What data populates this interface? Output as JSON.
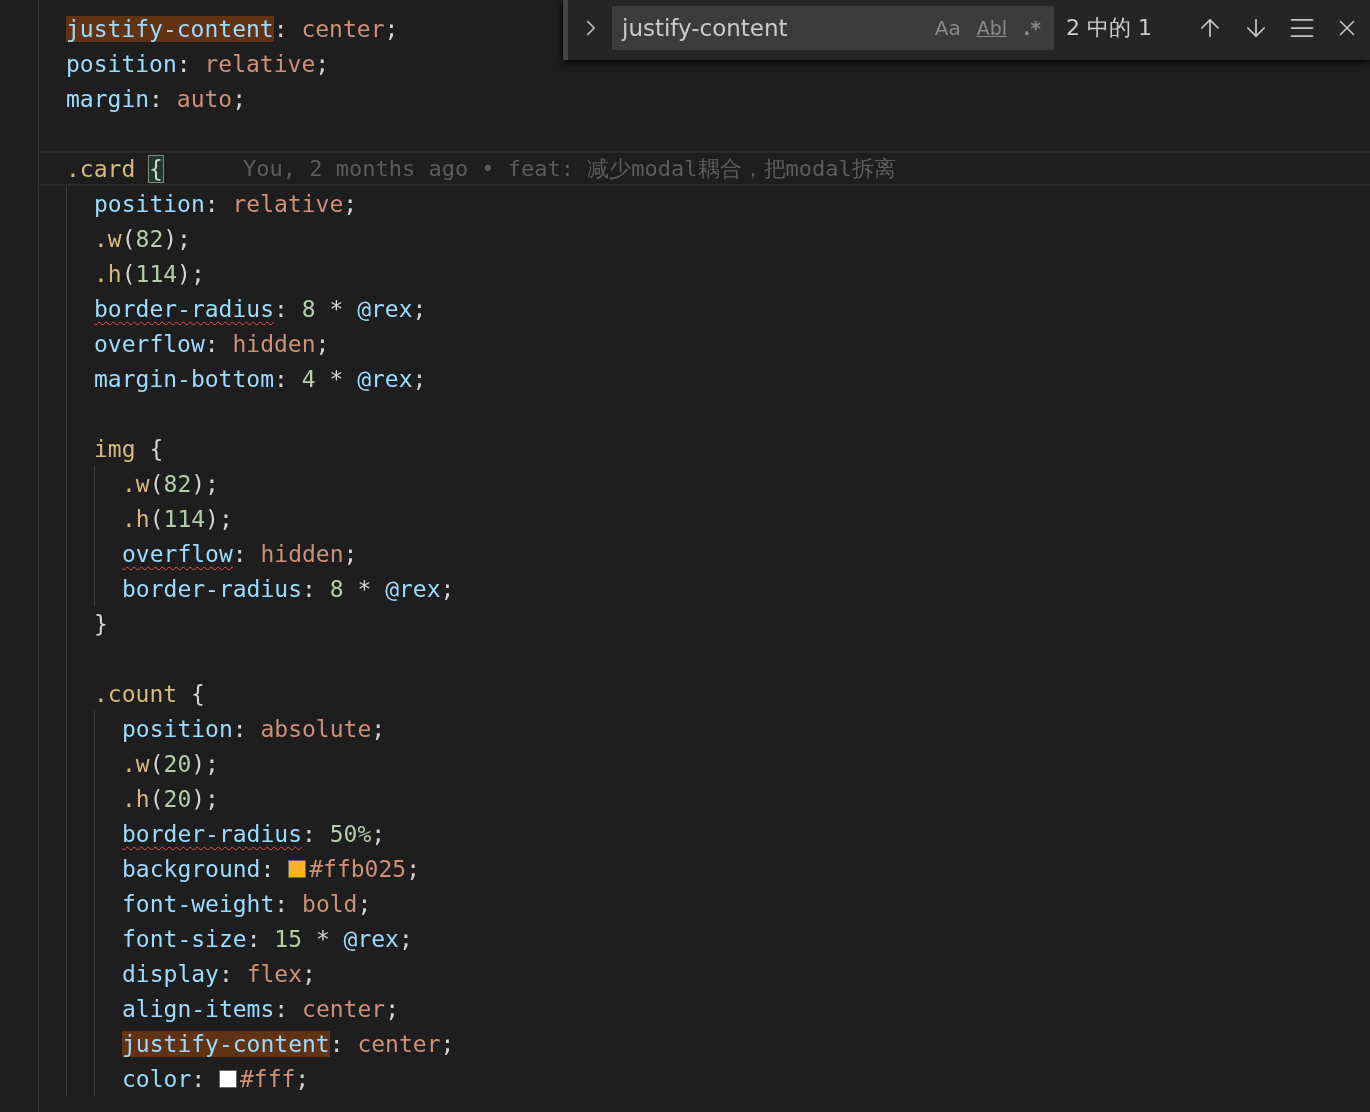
{
  "editor": {
    "lines": [
      {
        "tokens": [
          {
            "kind": "prop",
            "text": "justify-content",
            "highlighted": true
          },
          {
            "kind": "punct",
            "text": ": "
          },
          {
            "kind": "value",
            "text": "center"
          },
          {
            "kind": "punct",
            "text": ";"
          }
        ]
      },
      {
        "tokens": [
          {
            "kind": "prop",
            "text": "position"
          },
          {
            "kind": "punct",
            "text": ": "
          },
          {
            "kind": "value",
            "text": "relative"
          },
          {
            "kind": "punct",
            "text": ";"
          }
        ]
      },
      {
        "tokens": [
          {
            "kind": "prop",
            "text": "margin"
          },
          {
            "kind": "punct",
            "text": ": "
          },
          {
            "kind": "value",
            "text": "auto"
          },
          {
            "kind": "punct",
            "text": ";"
          }
        ]
      },
      {
        "kind": "blank"
      },
      {
        "current": true,
        "blame": "You, 2 months ago • feat: 减少modal耦合，把modal拆离",
        "tokens": [
          {
            "kind": "selector",
            "text": ".card "
          },
          {
            "kind": "punct",
            "text": "{",
            "bracket_match": true
          }
        ],
        "children": [
          {
            "tokens": [
              {
                "kind": "prop",
                "text": "position"
              },
              {
                "kind": "punct",
                "text": ": "
              },
              {
                "kind": "value",
                "text": "relative"
              },
              {
                "kind": "punct",
                "text": ";"
              }
            ]
          },
          {
            "tokens": [
              {
                "kind": "selector",
                "text": ".w"
              },
              {
                "kind": "punct",
                "text": "("
              },
              {
                "kind": "num",
                "text": "82"
              },
              {
                "kind": "punct",
                "text": ");"
              }
            ]
          },
          {
            "tokens": [
              {
                "kind": "selector",
                "text": ".h"
              },
              {
                "kind": "punct",
                "text": "("
              },
              {
                "kind": "num",
                "text": "114"
              },
              {
                "kind": "punct",
                "text": ");"
              }
            ]
          },
          {
            "tokens": [
              {
                "kind": "prop",
                "text": "border-radius",
                "warning": true
              },
              {
                "kind": "punct",
                "text": ": "
              },
              {
                "kind": "num",
                "text": "8"
              },
              {
                "kind": "punct",
                "text": " * "
              },
              {
                "kind": "var",
                "text": "@rex"
              },
              {
                "kind": "punct",
                "text": ";"
              }
            ]
          },
          {
            "tokens": [
              {
                "kind": "prop",
                "text": "overflow"
              },
              {
                "kind": "punct",
                "text": ": "
              },
              {
                "kind": "value",
                "text": "hidden"
              },
              {
                "kind": "punct",
                "text": ";"
              }
            ]
          },
          {
            "tokens": [
              {
                "kind": "prop",
                "text": "margin-bottom"
              },
              {
                "kind": "punct",
                "text": ": "
              },
              {
                "kind": "num",
                "text": "4"
              },
              {
                "kind": "punct",
                "text": " * "
              },
              {
                "kind": "var",
                "text": "@rex"
              },
              {
                "kind": "punct",
                "text": ";"
              }
            ]
          },
          {
            "kind": "blank"
          },
          {
            "tokens": [
              {
                "kind": "selector",
                "text": "img"
              },
              {
                "kind": "punct",
                "text": " {"
              }
            ],
            "children": [
              {
                "tokens": [
                  {
                    "kind": "selector",
                    "text": ".w"
                  },
                  {
                    "kind": "punct",
                    "text": "("
                  },
                  {
                    "kind": "num",
                    "text": "82"
                  },
                  {
                    "kind": "punct",
                    "text": ");"
                  }
                ]
              },
              {
                "tokens": [
                  {
                    "kind": "selector",
                    "text": ".h"
                  },
                  {
                    "kind": "punct",
                    "text": "("
                  },
                  {
                    "kind": "num",
                    "text": "114"
                  },
                  {
                    "kind": "punct",
                    "text": ");"
                  }
                ]
              },
              {
                "tokens": [
                  {
                    "kind": "prop",
                    "text": "overflow",
                    "warning": true
                  },
                  {
                    "kind": "punct",
                    "text": ": "
                  },
                  {
                    "kind": "value",
                    "text": "hidden"
                  },
                  {
                    "kind": "punct",
                    "text": ";"
                  }
                ]
              },
              {
                "tokens": [
                  {
                    "kind": "prop",
                    "text": "border-radius"
                  },
                  {
                    "kind": "punct",
                    "text": ": "
                  },
                  {
                    "kind": "num",
                    "text": "8"
                  },
                  {
                    "kind": "punct",
                    "text": " * "
                  },
                  {
                    "kind": "var",
                    "text": "@rex"
                  },
                  {
                    "kind": "punct",
                    "text": ";"
                  }
                ]
              }
            ]
          },
          {
            "tokens": [
              {
                "kind": "punct",
                "text": "}"
              }
            ]
          },
          {
            "kind": "blank"
          },
          {
            "tokens": [
              {
                "kind": "selector",
                "text": ".count"
              },
              {
                "kind": "punct",
                "text": " {"
              }
            ],
            "children": [
              {
                "tokens": [
                  {
                    "kind": "prop",
                    "text": "position"
                  },
                  {
                    "kind": "punct",
                    "text": ": "
                  },
                  {
                    "kind": "value",
                    "text": "absolute"
                  },
                  {
                    "kind": "punct",
                    "text": ";"
                  }
                ]
              },
              {
                "tokens": [
                  {
                    "kind": "selector",
                    "text": ".w"
                  },
                  {
                    "kind": "punct",
                    "text": "("
                  },
                  {
                    "kind": "num",
                    "text": "20"
                  },
                  {
                    "kind": "punct",
                    "text": ");"
                  }
                ]
              },
              {
                "tokens": [
                  {
                    "kind": "selector",
                    "text": ".h"
                  },
                  {
                    "kind": "punct",
                    "text": "("
                  },
                  {
                    "kind": "num",
                    "text": "20"
                  },
                  {
                    "kind": "punct",
                    "text": ");"
                  }
                ]
              },
              {
                "tokens": [
                  {
                    "kind": "prop",
                    "text": "border-radius",
                    "warning": true
                  },
                  {
                    "kind": "punct",
                    "text": ": "
                  },
                  {
                    "kind": "num",
                    "text": "50%"
                  },
                  {
                    "kind": "punct",
                    "text": ";"
                  }
                ]
              },
              {
                "tokens": [
                  {
                    "kind": "prop",
                    "text": "background"
                  },
                  {
                    "kind": "punct",
                    "text": ": "
                  },
                  {
                    "kind": "swatch",
                    "color": "#ffb025"
                  },
                  {
                    "kind": "value",
                    "text": "#ffb025"
                  },
                  {
                    "kind": "punct",
                    "text": ";"
                  }
                ]
              },
              {
                "tokens": [
                  {
                    "kind": "prop",
                    "text": "font-weight"
                  },
                  {
                    "kind": "punct",
                    "text": ": "
                  },
                  {
                    "kind": "value",
                    "text": "bold"
                  },
                  {
                    "kind": "punct",
                    "text": ";"
                  }
                ]
              },
              {
                "tokens": [
                  {
                    "kind": "prop",
                    "text": "font-size"
                  },
                  {
                    "kind": "punct",
                    "text": ": "
                  },
                  {
                    "kind": "num",
                    "text": "15"
                  },
                  {
                    "kind": "punct",
                    "text": " * "
                  },
                  {
                    "kind": "var",
                    "text": "@rex"
                  },
                  {
                    "kind": "punct",
                    "text": ";"
                  }
                ]
              },
              {
                "tokens": [
                  {
                    "kind": "prop",
                    "text": "display"
                  },
                  {
                    "kind": "punct",
                    "text": ": "
                  },
                  {
                    "kind": "value",
                    "text": "flex"
                  },
                  {
                    "kind": "punct",
                    "text": ";"
                  }
                ]
              },
              {
                "tokens": [
                  {
                    "kind": "prop",
                    "text": "align-items"
                  },
                  {
                    "kind": "punct",
                    "text": ": "
                  },
                  {
                    "kind": "value",
                    "text": "center"
                  },
                  {
                    "kind": "punct",
                    "text": ";"
                  }
                ]
              },
              {
                "tokens": [
                  {
                    "kind": "prop",
                    "text": "justify-content",
                    "highlighted": true
                  },
                  {
                    "kind": "punct",
                    "text": ": "
                  },
                  {
                    "kind": "value",
                    "text": "center"
                  },
                  {
                    "kind": "punct",
                    "text": ";"
                  }
                ]
              },
              {
                "tokens": [
                  {
                    "kind": "prop",
                    "text": "color"
                  },
                  {
                    "kind": "punct",
                    "text": ": "
                  },
                  {
                    "kind": "swatch",
                    "color": "#ffffff"
                  },
                  {
                    "kind": "value",
                    "text": "#fff"
                  },
                  {
                    "kind": "punct",
                    "text": ";"
                  }
                ]
              }
            ]
          }
        ]
      }
    ]
  },
  "find_widget": {
    "query": "justify-content",
    "options": [
      {
        "kind": "case",
        "label": "Aa",
        "on": false
      },
      {
        "kind": "word",
        "label": "Abl",
        "on": false
      },
      {
        "kind": "regex",
        "label": ".*",
        "on": false
      }
    ],
    "result": "2 中的 1"
  }
}
